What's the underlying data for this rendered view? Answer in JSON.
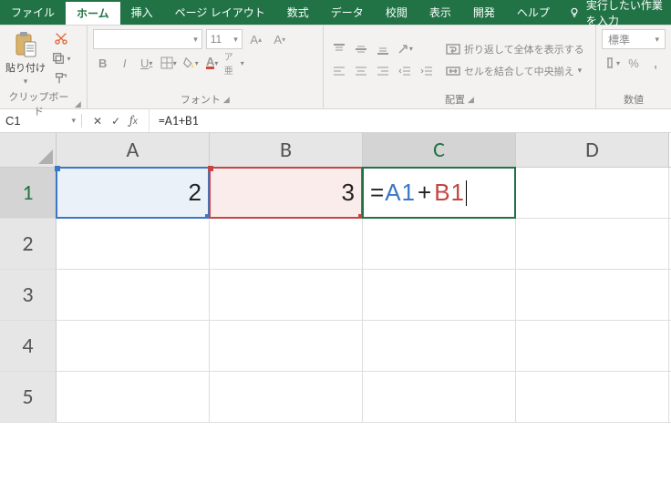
{
  "tabs": {
    "file": "ファイル",
    "home": "ホーム",
    "insert": "挿入",
    "pagelayout": "ページ レイアウト",
    "formulas": "数式",
    "data": "データ",
    "review": "校閲",
    "view": "表示",
    "developer": "開発",
    "help": "ヘルプ",
    "tellme": "実行したい作業を入力"
  },
  "ribbon": {
    "clipboard": {
      "paste": "貼り付け",
      "label": "クリップボード"
    },
    "font": {
      "name": "",
      "size": "11",
      "label": "フォント"
    },
    "alignment": {
      "wrap": "折り返して全体を表示する",
      "merge": "セルを結合して中央揃え",
      "label": "配置"
    },
    "number": {
      "format": "標準",
      "label": "数値"
    }
  },
  "namebox": "C1",
  "formulabar": "=A1+B1",
  "columns": [
    "A",
    "B",
    "C",
    "D"
  ],
  "rows": [
    "1",
    "2",
    "3",
    "4",
    "5"
  ],
  "cells": {
    "A1": "2",
    "B1": "3",
    "C1_tokens": {
      "eq": "=",
      "a1": "A1",
      "plus": "+",
      "b1": "B1"
    }
  },
  "active_cell": "C1",
  "ref_colors": {
    "A1": "#3b78c4",
    "B1": "#c44545"
  }
}
